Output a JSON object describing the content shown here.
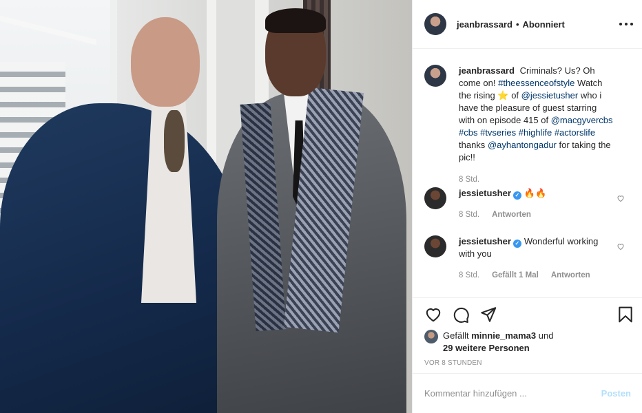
{
  "header": {
    "username": "jeanbrassard",
    "separator": "•",
    "follow_status": "Abonniert"
  },
  "caption": {
    "username": "jeanbrassard",
    "text_1": "Criminals? Us? Oh come on!",
    "tag_essence": "#theessenceofstyle",
    "text_2": "Watch the rising",
    "star": "⭐",
    "text_3": "of",
    "mention_jessie": "@jessietusher",
    "text_4": "who i have the pleasure of guest starring with on episode 415 of",
    "mention_macgyver": "@macgyvercbs",
    "tag_cbs": "#cbs",
    "tag_tvseries": "#tvseries",
    "tag_highlife": "#highlife",
    "tag_actorslife": "#actorslife",
    "text_5": "thanks",
    "mention_ayhan": "@ayhantongadur",
    "text_6": "for taking the pic!!",
    "time": "8 Std."
  },
  "comments": [
    {
      "username": "jessietusher",
      "text": "🔥🔥",
      "time": "8 Std.",
      "reply": "Antworten"
    },
    {
      "username": "jessietusher",
      "text": "Wonderful working with you",
      "time": "8 Std.",
      "likes": "Gefällt 1 Mal",
      "reply": "Antworten"
    }
  ],
  "verified_mark": "✓",
  "likes": {
    "prefix": "Gefällt",
    "user": "minnie_mama3",
    "middle": "und",
    "others": "29 weitere Personen"
  },
  "timestamp": "VOR 8 STUNDEN",
  "add_comment": {
    "placeholder": "Kommentar hinzufügen ...",
    "post_label": "Posten"
  },
  "icons": {
    "like": "heart-icon",
    "comment": "comment-icon",
    "share": "paper-plane-icon",
    "save": "bookmark-icon",
    "more": "more-horizontal-icon",
    "verified": "verified-badge-icon"
  },
  "colors": {
    "link": "#00376b",
    "verified": "#3897f0",
    "muted": "#8e8e8e",
    "post_disabled": "#b2dffc"
  }
}
